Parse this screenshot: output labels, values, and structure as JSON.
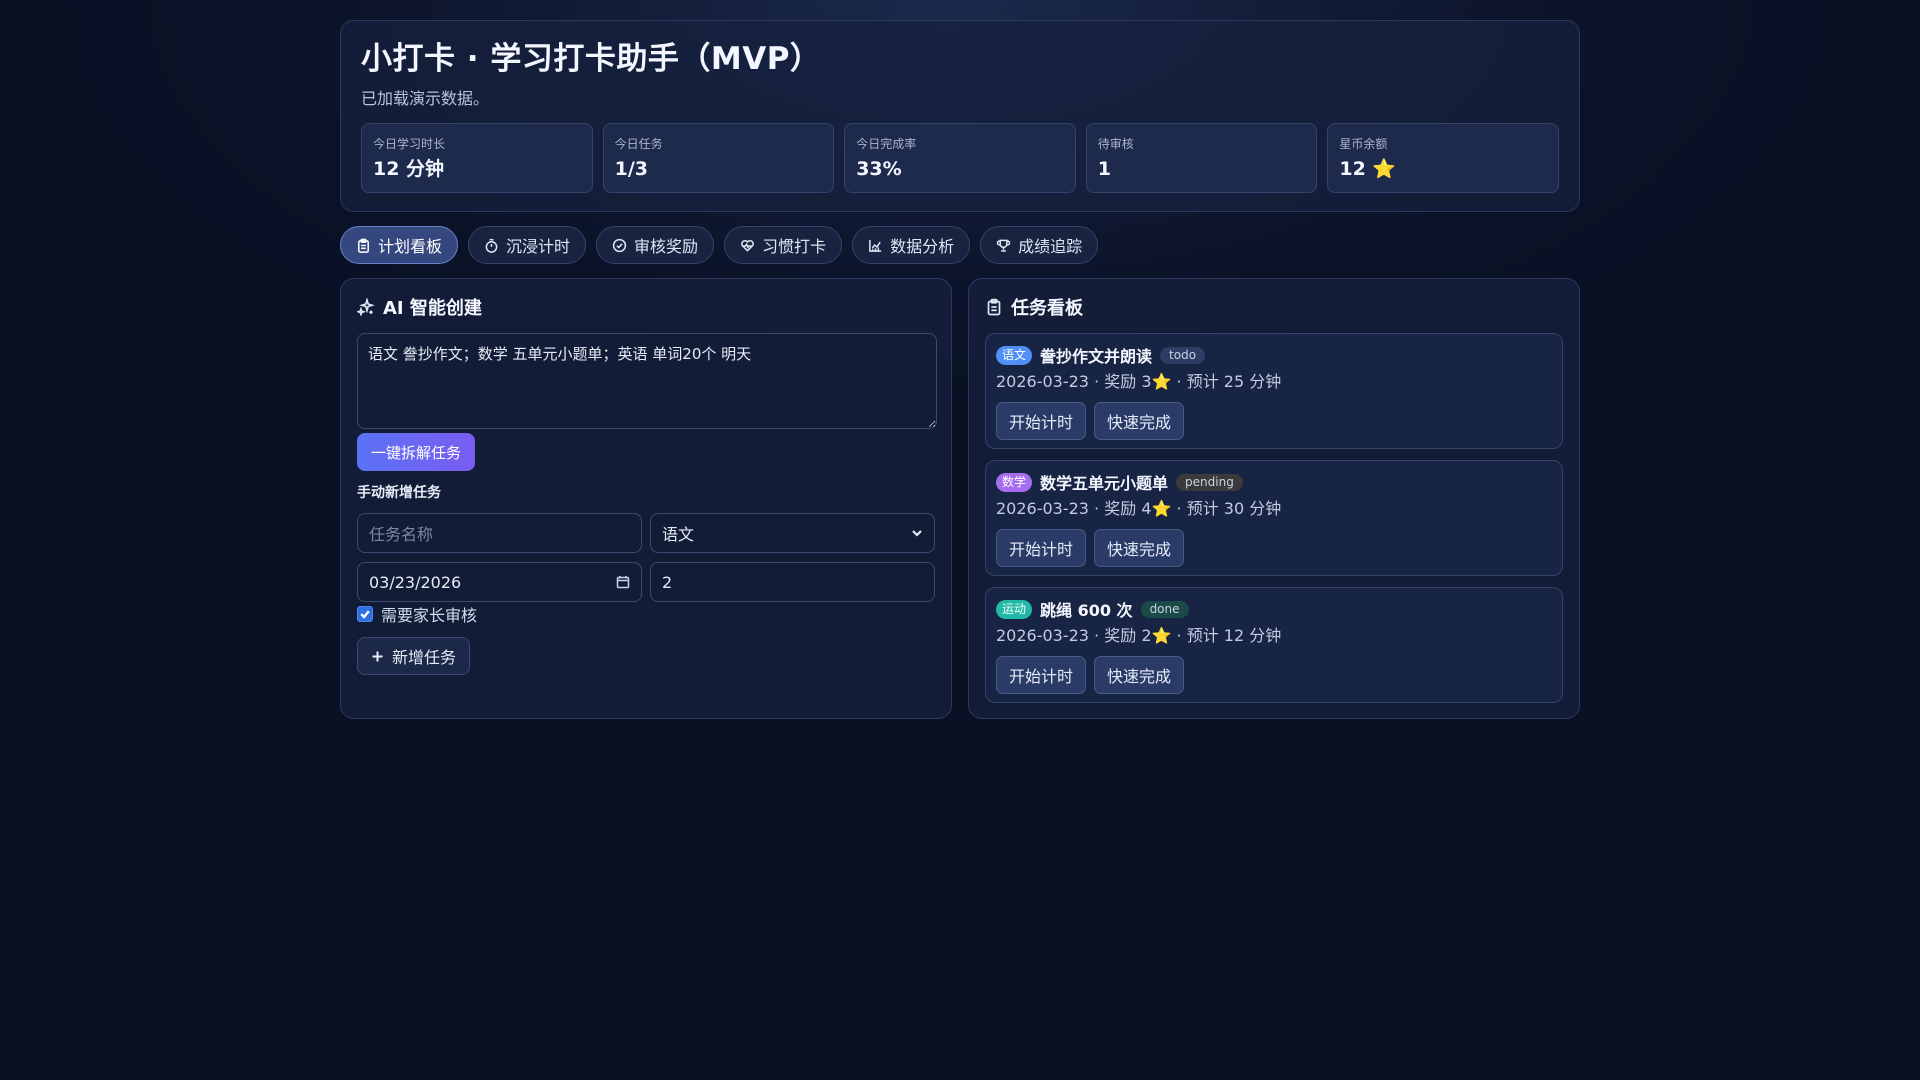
{
  "header": {
    "title": "小打卡 · 学习打卡助手（MVP）",
    "subtitle": "已加载演示数据。",
    "stats": [
      {
        "label": "今日学习时长",
        "value": "12 分钟"
      },
      {
        "label": "今日任务",
        "value": "1/3"
      },
      {
        "label": "今日完成率",
        "value": "33%"
      },
      {
        "label": "待审核",
        "value": "1"
      },
      {
        "label": "星币余额",
        "value": "12 ⭐"
      }
    ]
  },
  "tabs": [
    {
      "label": "计划看板",
      "icon": "clipboard-icon",
      "active": true
    },
    {
      "label": "沉浸计时",
      "icon": "timer-icon",
      "active": false
    },
    {
      "label": "审核奖励",
      "icon": "check-circle-icon",
      "active": false
    },
    {
      "label": "习惯打卡",
      "icon": "heart-pulse-icon",
      "active": false
    },
    {
      "label": "数据分析",
      "icon": "chart-icon",
      "active": false
    },
    {
      "label": "成绩追踪",
      "icon": "trophy-icon",
      "active": false
    }
  ],
  "ai_panel": {
    "title": "AI 智能创建",
    "input_value": "语文 誊抄作文；数学 五单元小题单；英语 单词20个 明天",
    "split_button": "一键拆解任务",
    "manual_label": "手动新增任务",
    "task_name_placeholder": "任务名称",
    "subject_selected": "语文",
    "date_value": "03/23/2026",
    "reward_value": "2",
    "needs_review_label": "需要家长审核",
    "needs_review_checked": true,
    "add_button": "新增任务"
  },
  "board": {
    "title": "任务看板",
    "start_label": "开始计时",
    "finish_label": "快速完成",
    "tasks": [
      {
        "subject": "语文",
        "name": "誊抄作文并朗读",
        "status": "todo",
        "meta": "2026-03-23 · 奖励 3⭐ · 预计 25 分钟"
      },
      {
        "subject": "数学",
        "name": "数学五单元小题单",
        "status": "pending",
        "meta": "2026-03-23 · 奖励 4⭐ · 预计 30 分钟"
      },
      {
        "subject": "运动",
        "name": "跳绳 600 次",
        "status": "done",
        "meta": "2026-03-23 · 奖励 2⭐ · 预计 12 分钟"
      }
    ]
  },
  "colors": {
    "accent": "#5b72f5",
    "subject_chinese": "#4f8ff7",
    "subject_math": "#a66cf0",
    "subject_sport": "#20b8a6",
    "status_todo": "#2e3d63",
    "status_pending": "#3b3a3a",
    "status_done": "#1b4a48"
  }
}
